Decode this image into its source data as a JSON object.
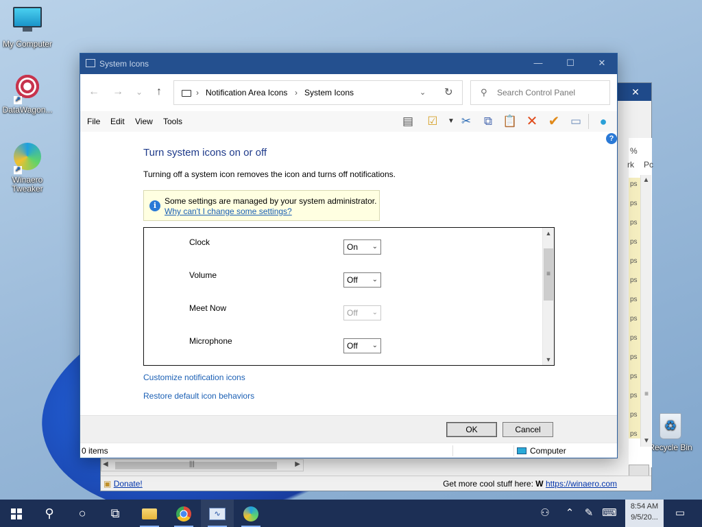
{
  "desktop": {
    "icons": [
      {
        "label": "My Computer"
      },
      {
        "label": "DataWagon..."
      },
      {
        "label": "Winaero Tweaker"
      },
      {
        "label": "Recycle Bin"
      }
    ]
  },
  "background_window": {
    "percent_header": "%",
    "col_rk": "rk",
    "col_pc": "Pc",
    "row_text": "ps",
    "donate_prefix": "",
    "donate_label": "Donate!",
    "more_stuff": "Get more cool stuff here:",
    "winaero_glyph": "W",
    "winaero_link": "https://winaero.com"
  },
  "window": {
    "title": "System Icons",
    "controls": {
      "minimize": "—",
      "maximize": "☐",
      "close": "✕"
    },
    "nav": {
      "back": "←",
      "forward": "→",
      "recent": "⌄",
      "up": "↑"
    },
    "address": {
      "crumbs": [
        "Notification Area Icons",
        "System Icons"
      ],
      "separator": "›"
    },
    "search": {
      "placeholder": "Search Control Panel"
    },
    "menu": [
      "File",
      "Edit",
      "View",
      "Tools"
    ],
    "toolbar_icons": [
      "pane-icon",
      "checklist-icon",
      "cut-icon",
      "copy-icon",
      "paste-icon",
      "delete-icon",
      "check-icon",
      "properties-icon",
      "globe-icon"
    ],
    "content": {
      "heading": "Turn system icons on or off",
      "description": "Turning off a system icon removes the icon and turns off notifications.",
      "info_message": "Some settings are managed by your system administrator.",
      "info_link": "Why can't I change some settings?",
      "rows": [
        {
          "label": "Clock",
          "value": "On",
          "disabled": false
        },
        {
          "label": "Volume",
          "value": "Off",
          "disabled": false
        },
        {
          "label": "Meet Now",
          "value": "Off",
          "disabled": true
        },
        {
          "label": "Microphone",
          "value": "Off",
          "disabled": false
        }
      ],
      "link_customize": "Customize notification icons",
      "link_restore": "Restore default icon behaviors"
    },
    "buttons": {
      "ok": "OK",
      "cancel": "Cancel"
    },
    "status": {
      "items": "0 items",
      "location": "Computer"
    }
  },
  "taskbar": {
    "time": "8:54 AM",
    "date": "9/5/20..."
  },
  "colors": {
    "title_bar": "#24508f",
    "heading": "#1e3a8a",
    "link": "#1a5fb4",
    "info_bar": "#ffffe1",
    "taskbar": "#1c2f55"
  }
}
